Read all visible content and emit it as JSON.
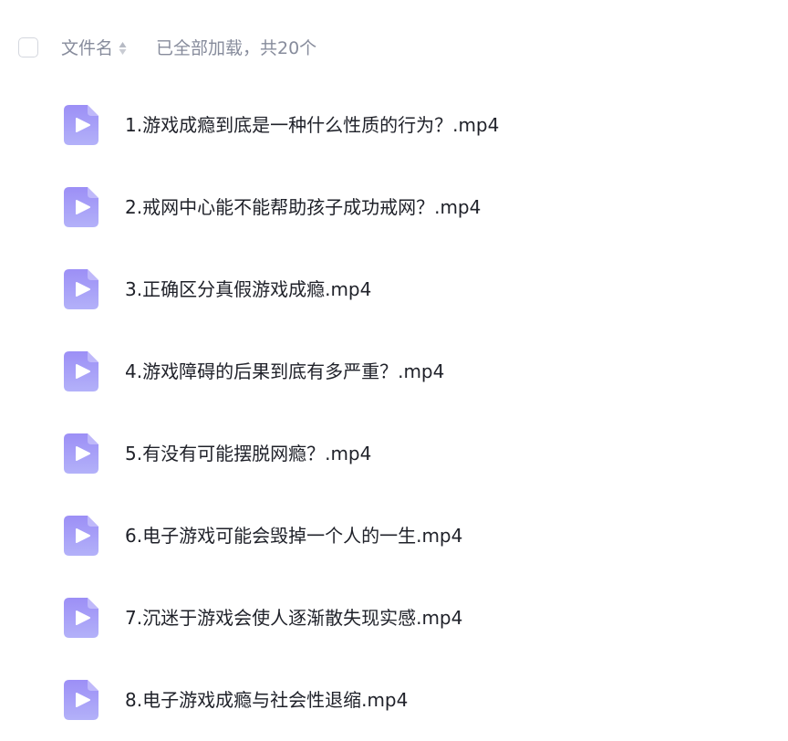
{
  "header": {
    "column_label": "文件名",
    "status_text": "已全部加载，共20个",
    "sort_icon": "sort-updown-icon"
  },
  "files": [
    {
      "name": "1.游戏成瘾到底是一种什么性质的行为？.mp4",
      "icon": "video-file-icon"
    },
    {
      "name": "2.戒网中心能不能帮助孩子成功戒网？.mp4",
      "icon": "video-file-icon"
    },
    {
      "name": "3.正确区分真假游戏成瘾.mp4",
      "icon": "video-file-icon"
    },
    {
      "name": "4.游戏障碍的后果到底有多严重？.mp4",
      "icon": "video-file-icon"
    },
    {
      "name": "5.有没有可能摆脱网瘾？.mp4",
      "icon": "video-file-icon"
    },
    {
      "name": "6.电子游戏可能会毁掉一个人的一生.mp4",
      "icon": "video-file-icon"
    },
    {
      "name": "7.沉迷于游戏会使人逐渐散失现实感.mp4",
      "icon": "video-file-icon"
    },
    {
      "name": "8.电子游戏成瘾与社会性退缩.mp4",
      "icon": "video-file-icon"
    }
  ],
  "colors": {
    "icon_top": "#9c8ff6",
    "icon_bottom": "#b3b1f9",
    "text_primary": "#1f2129",
    "text_secondary": "#878c9c",
    "checkbox_border": "#d4d7de"
  }
}
